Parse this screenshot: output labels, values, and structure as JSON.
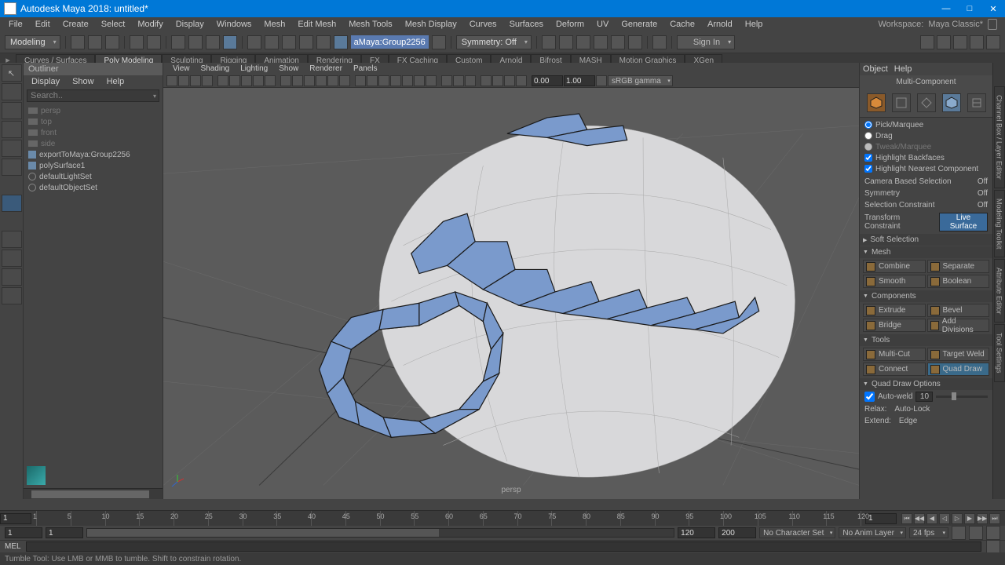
{
  "app": {
    "title": "Autodesk Maya 2018: untitled*"
  },
  "winbuttons": {
    "min": "—",
    "max": "□",
    "close": "✕"
  },
  "menubar": [
    "File",
    "Edit",
    "Create",
    "Select",
    "Modify",
    "Display",
    "Windows",
    "Mesh",
    "Edit Mesh",
    "Mesh Tools",
    "Mesh Display",
    "Curves",
    "Surfaces",
    "Deform",
    "UV",
    "Generate",
    "Cache",
    "Arnold",
    "Help"
  ],
  "workspace": {
    "label": "Workspace:",
    "value": "Maya Classic*"
  },
  "mode_selector": "Modeling",
  "selected_object": "aMaya:Group2256",
  "symmetry": "Symmetry: Off",
  "signin": "Sign In",
  "shelf_tabs": [
    "Curves / Surfaces",
    "Poly Modeling",
    "Sculpting",
    "Rigging",
    "Animation",
    "Rendering",
    "FX",
    "FX Caching",
    "Custom",
    "Arnold",
    "Bifrost",
    "MASH",
    "Motion Graphics",
    "XGen"
  ],
  "shelf_active": 1,
  "outliner": {
    "title": "Outliner",
    "menu": [
      "Display",
      "Show",
      "Help"
    ],
    "search": "Search..",
    "items": [
      {
        "name": "persp",
        "type": "cam",
        "dim": true
      },
      {
        "name": "top",
        "type": "cam",
        "dim": true
      },
      {
        "name": "front",
        "type": "cam",
        "dim": true
      },
      {
        "name": "side",
        "type": "cam",
        "dim": true
      },
      {
        "name": "exportToMaya:Group2256",
        "type": "grp",
        "dim": false
      },
      {
        "name": "polySurface1",
        "type": "grp",
        "dim": false
      },
      {
        "name": "defaultLightSet",
        "type": "set",
        "dim": false
      },
      {
        "name": "defaultObjectSet",
        "type": "set",
        "dim": false
      }
    ]
  },
  "viewport": {
    "menu": [
      "View",
      "Shading",
      "Lighting",
      "Show",
      "Renderer",
      "Panels"
    ],
    "near": "0.00",
    "far": "1.00",
    "colorspace": "sRGB gamma",
    "label": "persp"
  },
  "rpanel": {
    "menu": [
      "Object",
      "Help"
    ],
    "multi_component": "Multi-Component",
    "pick_marquee": "Pick/Marquee",
    "drag": "Drag",
    "tweak": "Tweak/Marquee",
    "hl_backfaces": "Highlight Backfaces",
    "hl_nearest": "Highlight Nearest Component",
    "cam_sel": "Camera Based Selection",
    "cam_sel_val": "Off",
    "sym": "Symmetry",
    "sym_val": "Off",
    "sel_con": "Selection Constraint",
    "sel_con_val": "Off",
    "trans_con": "Transform Constraint",
    "trans_con_val": "Live Surface",
    "soft_sel": "Soft Selection",
    "mesh_hdr": "Mesh",
    "combine": "Combine",
    "separate": "Separate",
    "smooth": "Smooth",
    "boolean": "Boolean",
    "comp_hdr": "Components",
    "extrude": "Extrude",
    "bevel": "Bevel",
    "bridge": "Bridge",
    "add_div": "Add Divisions",
    "tools_hdr": "Tools",
    "multicut": "Multi-Cut",
    "target_weld": "Target Weld",
    "connect": "Connect",
    "quad_draw": "Quad Draw",
    "qdo_hdr": "Quad Draw Options",
    "auto_weld": "Auto-weld",
    "auto_weld_val": "10",
    "relax": "Relax:",
    "auto_lock": "Auto-Lock",
    "extend": "Extend:",
    "extend_val": "Edge"
  },
  "side_tabs": [
    "Channel Box / Layer Editor",
    "Modeling Toolkit",
    "Attribute Editor",
    "Tool Settings"
  ],
  "timeline": {
    "start": "1",
    "ticks": [
      "1",
      "5",
      "10",
      "15",
      "20",
      "25",
      "30",
      "35",
      "40",
      "45",
      "50",
      "55",
      "60",
      "65",
      "70",
      "75",
      "80",
      "85",
      "90",
      "95",
      "100",
      "105",
      "110",
      "115",
      "120"
    ]
  },
  "range": {
    "start_outer": "1",
    "start_inner": "1",
    "end_inner": "120",
    "end_outer": "200",
    "char_set": "No Character Set",
    "anim_layer": "No Anim Layer",
    "fps": "24 fps"
  },
  "cmd": {
    "label": "MEL"
  },
  "status": "Tumble Tool: Use LMB or MMB to tumble. Shift to constrain rotation."
}
